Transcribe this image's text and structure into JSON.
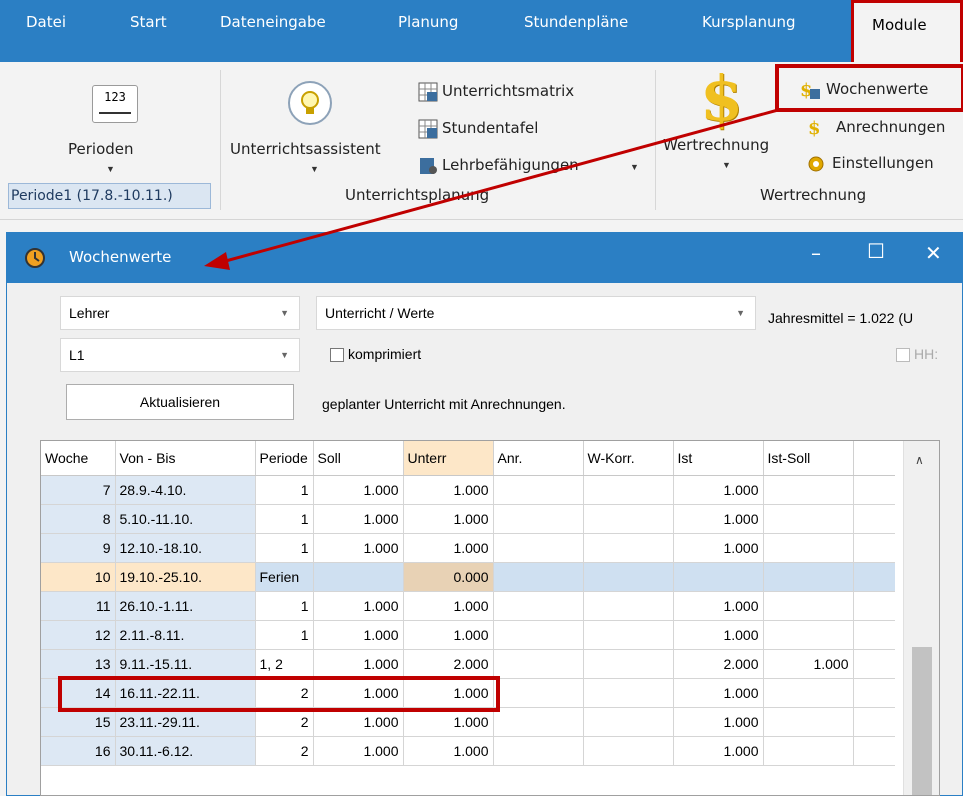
{
  "menu": {
    "items": [
      "Datei",
      "Start",
      "Dateneingabe",
      "Planung",
      "Stundenpläne",
      "Kursplanung",
      "Module"
    ]
  },
  "ribbon": {
    "perioden_label": "Perioden",
    "perioden_icon_text": "123",
    "period_box": "Periode1 (17.8.-10.11.)",
    "unterrichtsassistent_label": "Unterrichtsassistent",
    "unterrichtsmatrix": "Unterrichtsmatrix",
    "stundentafel": "Stundentafel",
    "lehrbefaehigungen": "Lehrbefähigungen",
    "group_unterrichtsplanung": "Unterrichtsplanung",
    "wertrechnung_label": "Wertrechnung",
    "wochenwerte": "Wochenwerte",
    "anrechnungen": "Anrechnungen",
    "einstellungen": "Einstellungen",
    "group_wertrechnung": "Wertrechnung",
    "dollar_glyph": "$"
  },
  "window": {
    "title": "Wochenwerte",
    "combo1": "Lehrer",
    "combo2": "L1",
    "combo3": "Unterricht / Werte",
    "jahresmittel": "Jahresmittel = 1.022 (U",
    "komprimiert": "komprimiert",
    "hh": "HH:",
    "aktualisieren": "Aktualisieren",
    "info": "geplanter Unterricht mit Anrechnungen."
  },
  "grid": {
    "headers": [
      "Woche",
      "Von - Bis",
      "Periode",
      "Soll",
      "Unterr",
      "Anr.",
      "W-Korr.",
      "Ist",
      "Ist-Soll"
    ],
    "rows": [
      {
        "woche": "7",
        "von_bis": "28.9.-4.10.",
        "periode": "1",
        "soll": "1.000",
        "unterr": "1.000",
        "anr": "",
        "wkorr": "",
        "ist": "1.000",
        "istsoll": ""
      },
      {
        "woche": "8",
        "von_bis": "5.10.-11.10.",
        "periode": "1",
        "soll": "1.000",
        "unterr": "1.000",
        "anr": "",
        "wkorr": "",
        "ist": "1.000",
        "istsoll": ""
      },
      {
        "woche": "9",
        "von_bis": "12.10.-18.10.",
        "periode": "1",
        "soll": "1.000",
        "unterr": "1.000",
        "anr": "",
        "wkorr": "",
        "ist": "1.000",
        "istsoll": ""
      },
      {
        "woche": "10",
        "von_bis": "19.10.-25.10.",
        "periode": "Ferien",
        "soll": "",
        "unterr": "0.000",
        "anr": "",
        "wkorr": "",
        "ist": "",
        "istsoll": ""
      },
      {
        "woche": "11",
        "von_bis": "26.10.-1.11.",
        "periode": "1",
        "soll": "1.000",
        "unterr": "1.000",
        "anr": "",
        "wkorr": "",
        "ist": "1.000",
        "istsoll": ""
      },
      {
        "woche": "12",
        "von_bis": "2.11.-8.11.",
        "periode": "1",
        "soll": "1.000",
        "unterr": "1.000",
        "anr": "",
        "wkorr": "",
        "ist": "1.000",
        "istsoll": ""
      },
      {
        "woche": "13",
        "von_bis": "9.11.-15.11.",
        "periode": "1, 2",
        "soll": "1.000",
        "unterr": "2.000",
        "anr": "",
        "wkorr": "",
        "ist": "2.000",
        "istsoll": "1.000"
      },
      {
        "woche": "14",
        "von_bis": "16.11.-22.11.",
        "periode": "2",
        "soll": "1.000",
        "unterr": "1.000",
        "anr": "",
        "wkorr": "",
        "ist": "1.000",
        "istsoll": ""
      },
      {
        "woche": "15",
        "von_bis": "23.11.-29.11.",
        "periode": "2",
        "soll": "1.000",
        "unterr": "1.000",
        "anr": "",
        "wkorr": "",
        "ist": "1.000",
        "istsoll": ""
      },
      {
        "woche": "16",
        "von_bis": "30.11.-6.12.",
        "periode": "2",
        "soll": "1.000",
        "unterr": "1.000",
        "anr": "",
        "wkorr": "",
        "ist": "1.000",
        "istsoll": ""
      }
    ]
  },
  "colors": {
    "titlebar": "#2b7fc4",
    "annotation": "#c00000",
    "holiday_row": "#fde7c8"
  }
}
